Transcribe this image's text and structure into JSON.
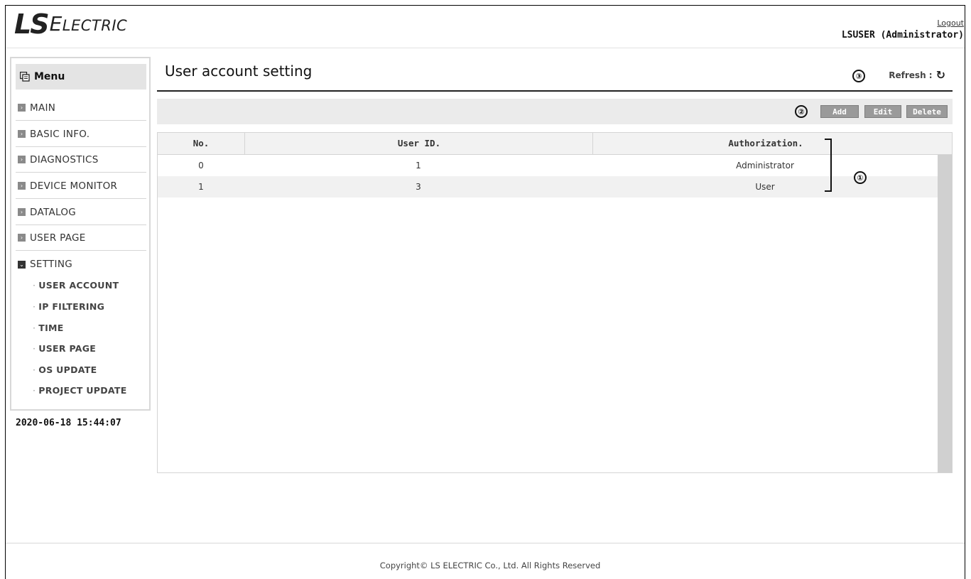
{
  "header": {
    "logo_ls": "LS",
    "logo_electric_first": "E",
    "logo_electric_rest": "LECTRIC",
    "logout_label": "Logout",
    "user_line": "LSUSER (Administrator)"
  },
  "sidebar": {
    "menu_label": "Menu",
    "items": [
      {
        "label": "MAIN",
        "expanded": false
      },
      {
        "label": "BASIC INFO.",
        "expanded": false
      },
      {
        "label": "DIAGNOSTICS",
        "expanded": false
      },
      {
        "label": "DEVICE MONITOR",
        "expanded": false
      },
      {
        "label": "DATALOG",
        "expanded": false
      },
      {
        "label": "USER PAGE",
        "expanded": false
      },
      {
        "label": "SETTING",
        "expanded": true
      }
    ],
    "sub_items": [
      "USER ACCOUNT",
      "IP FILTERING",
      "TIME",
      "USER PAGE",
      "OS UPDATE",
      "PROJECT UPDATE"
    ],
    "datetime": "2020-06-18 15:44:07"
  },
  "main": {
    "title": "User account setting",
    "refresh_label": "Refresh :",
    "callouts": [
      "①",
      "②",
      "③"
    ],
    "buttons": {
      "add": "Add",
      "edit": "Edit",
      "delete": "Delete"
    },
    "table": {
      "headers": [
        "No.",
        "User ID.",
        "Authorization."
      ],
      "rows": [
        [
          "0",
          "1",
          "Administrator"
        ],
        [
          "1",
          "3",
          "User"
        ]
      ]
    }
  },
  "footer": {
    "copyright": "Copyright© LS ELECTRIC Co., Ltd. All Rights Reserved"
  },
  "colors": {
    "accent": "#222222",
    "button_bg": "#9a9a9a",
    "menu_head_bg": "#e4e4e4",
    "row_alt_bg": "#f1f1f1"
  }
}
